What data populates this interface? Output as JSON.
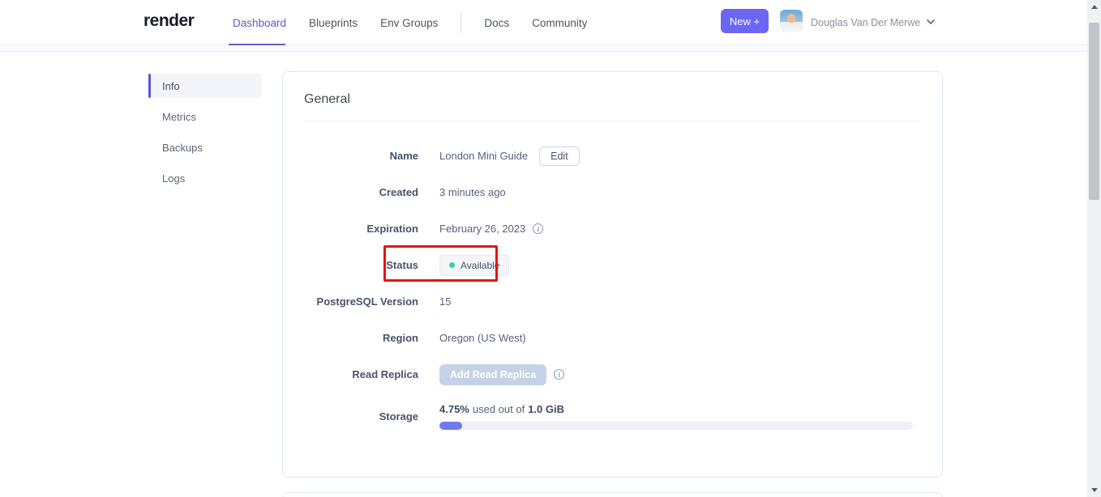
{
  "header": {
    "logo": "render",
    "nav": [
      {
        "label": "Dashboard",
        "active": true
      },
      {
        "label": "Blueprints",
        "active": false
      },
      {
        "label": "Env Groups",
        "active": false
      },
      {
        "label": "Docs",
        "active": false
      },
      {
        "label": "Community",
        "active": false
      }
    ],
    "new_button": "New +",
    "user": {
      "name": "Douglas Van Der Merwe"
    }
  },
  "sidebar": {
    "items": [
      {
        "label": "Info",
        "active": true
      },
      {
        "label": "Metrics",
        "active": false
      },
      {
        "label": "Backups",
        "active": false
      },
      {
        "label": "Logs",
        "active": false
      }
    ]
  },
  "general": {
    "title": "General",
    "name": {
      "label": "Name",
      "value": "London Mini Guide",
      "edit_button": "Edit"
    },
    "created": {
      "label": "Created",
      "value": "3 minutes ago"
    },
    "expiration": {
      "label": "Expiration",
      "value": "February 26, 2023"
    },
    "status": {
      "label": "Status",
      "badge": "Available"
    },
    "version": {
      "label": "PostgreSQL Version",
      "value": "15"
    },
    "region": {
      "label": "Region",
      "value": "Oregon (US West)"
    },
    "read_replica": {
      "label": "Read Replica",
      "button": "Add Read Replica"
    },
    "storage": {
      "label": "Storage",
      "used_percent": "4.75%",
      "middle_text": "used out of",
      "total": "1.0 GiB",
      "percent_value": 4.75
    }
  },
  "icons": {
    "info": "i",
    "plus": "+",
    "chevron_down": "v"
  },
  "colors": {
    "accent_purple": "#6B66F5",
    "nav_active_purple": "#5F58C9",
    "status_dot_green": "#36D39F",
    "annotation_red": "#E51414",
    "progress_fill": "#6E79F3",
    "disabled_button_bg": "#C5D2E6"
  },
  "annotation": {
    "type": "red-box",
    "target": "status-row"
  }
}
